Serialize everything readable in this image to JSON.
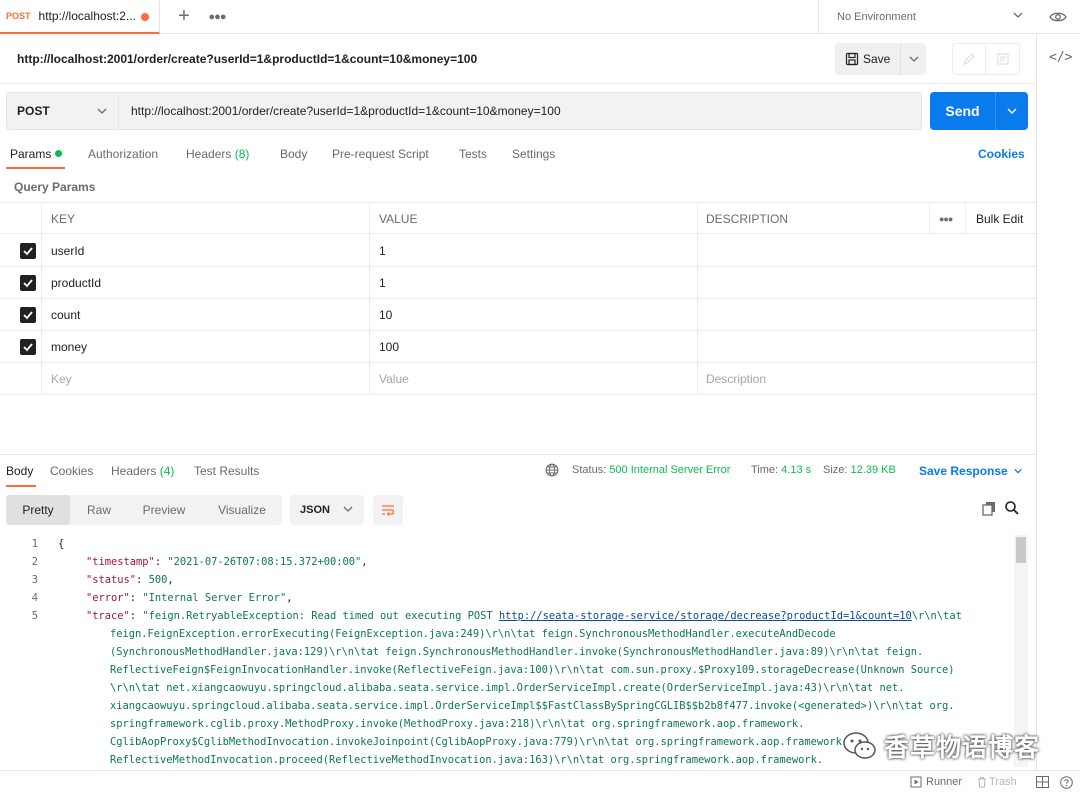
{
  "tab": {
    "method": "POST",
    "title": "http://localhost:2..."
  },
  "environment": {
    "selected": "No Environment"
  },
  "request": {
    "name": "http://localhost:2001/order/create?userId=1&productId=1&count=10&money=100",
    "method": "POST",
    "url": "http://localhost:2001/order/create?userId=1&productId=1&count=10&money=100",
    "save_label": "Save",
    "send_label": "Send"
  },
  "request_tabs": {
    "params": "Params",
    "authorization": "Authorization",
    "headers": "Headers",
    "headers_count": "(8)",
    "body": "Body",
    "prerequest": "Pre-request Script",
    "tests": "Tests",
    "settings": "Settings",
    "cookies": "Cookies"
  },
  "query_params": {
    "title": "Query Params",
    "columns": {
      "key": "KEY",
      "value": "VALUE",
      "description": "DESCRIPTION",
      "bulk_edit": "Bulk Edit"
    },
    "rows": [
      {
        "key": "userId",
        "value": "1",
        "checked": true
      },
      {
        "key": "productId",
        "value": "1",
        "checked": true
      },
      {
        "key": "count",
        "value": "10",
        "checked": true
      },
      {
        "key": "money",
        "value": "100",
        "checked": true
      }
    ],
    "placeholders": {
      "key": "Key",
      "value": "Value",
      "description": "Description"
    }
  },
  "response_tabs": {
    "body": "Body",
    "cookies": "Cookies",
    "headers": "Headers",
    "headers_count": "(4)",
    "test_results": "Test Results"
  },
  "response_status": {
    "status_label": "Status:",
    "status_value": "500 Internal Server Error",
    "time_label": "Time:",
    "time_value": "4.13 s",
    "size_label": "Size:",
    "size_value": "12.39 KB",
    "save_response": "Save Response"
  },
  "response_view": {
    "modes": [
      "Pretty",
      "Raw",
      "Preview",
      "Visualize"
    ],
    "active_mode": "Pretty",
    "format": "JSON"
  },
  "response_body": {
    "line_numbers": [
      "1",
      "2",
      "3",
      "4",
      "5"
    ],
    "open_brace": "{",
    "timestamp_key": "\"timestamp\"",
    "timestamp_value": "\"2021-07-26T07:08:15.372+00:00\"",
    "status_key": "\"status\"",
    "status_value": "500",
    "error_key": "\"error\"",
    "error_value": "\"Internal Server Error\"",
    "trace_key": "\"trace\"",
    "trace_prefix": "\"feign.RetryableException: Read timed out executing POST ",
    "trace_url": "http://seata-storage-service/storage/decrease?productId=1&count=10",
    "trace_suffix": "\\r\\n\\tat",
    "trace_wrapped": [
      "feign.FeignException.errorExecuting(FeignException.java:249)\\r\\n\\tat feign.SynchronousMethodHandler.executeAndDecode",
      "(SynchronousMethodHandler.java:129)\\r\\n\\tat feign.SynchronousMethodHandler.invoke(SynchronousMethodHandler.java:89)\\r\\n\\tat feign.",
      "ReflectiveFeign$FeignInvocationHandler.invoke(ReflectiveFeign.java:100)\\r\\n\\tat com.sun.proxy.$Proxy109.storageDecrease(Unknown Source)",
      "\\r\\n\\tat net.xiangcaowuyu.springcloud.alibaba.seata.service.impl.OrderServiceImpl.create(OrderServiceImpl.java:43)\\r\\n\\tat net.",
      "xiangcaowuyu.springcloud.alibaba.seata.service.impl.OrderServiceImpl$$FastClassBySpringCGLIB$$b2b8f477.invoke(<generated>)\\r\\n\\tat org.",
      "springframework.cglib.proxy.MethodProxy.invoke(MethodProxy.java:218)\\r\\n\\tat org.springframework.aop.framework.",
      "CglibAopProxy$CglibMethodInvocation.invokeJoinpoint(CglibAopProxy.java:779)\\r\\n\\tat org.springframework.aop.framework.",
      "ReflectiveMethodInvocation.proceed(ReflectiveMethodInvocation.java:163)\\r\\n\\tat org.springframework.aop.framework."
    ]
  },
  "watermark": {
    "text": "香草物语博客"
  },
  "footer": {
    "runner": "Runner",
    "trash": "Trash"
  },
  "colors": {
    "accent": "#ff6c37",
    "send": "#097bed",
    "success": "#0cbb52",
    "json_key": "#a2162a",
    "json_string": "#0b7a4b"
  }
}
